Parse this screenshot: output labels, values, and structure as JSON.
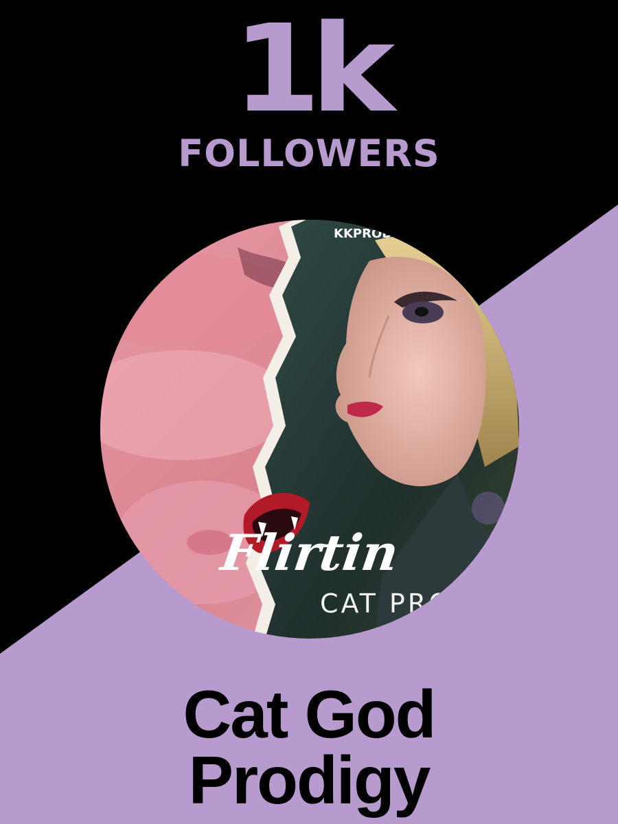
{
  "milestone": {
    "count": "1k",
    "unit": "FOLLOWERS"
  },
  "artwork": {
    "label_top": "KKPROD",
    "title": "Flirtin",
    "subtitle": "CAT PROD"
  },
  "artist": {
    "name_line1": "Cat God",
    "name_line2": "Prodigy"
  },
  "colors": {
    "background_dark": "#000000",
    "accent_lavender": "#b79bcf",
    "artist_text": "#000000"
  }
}
